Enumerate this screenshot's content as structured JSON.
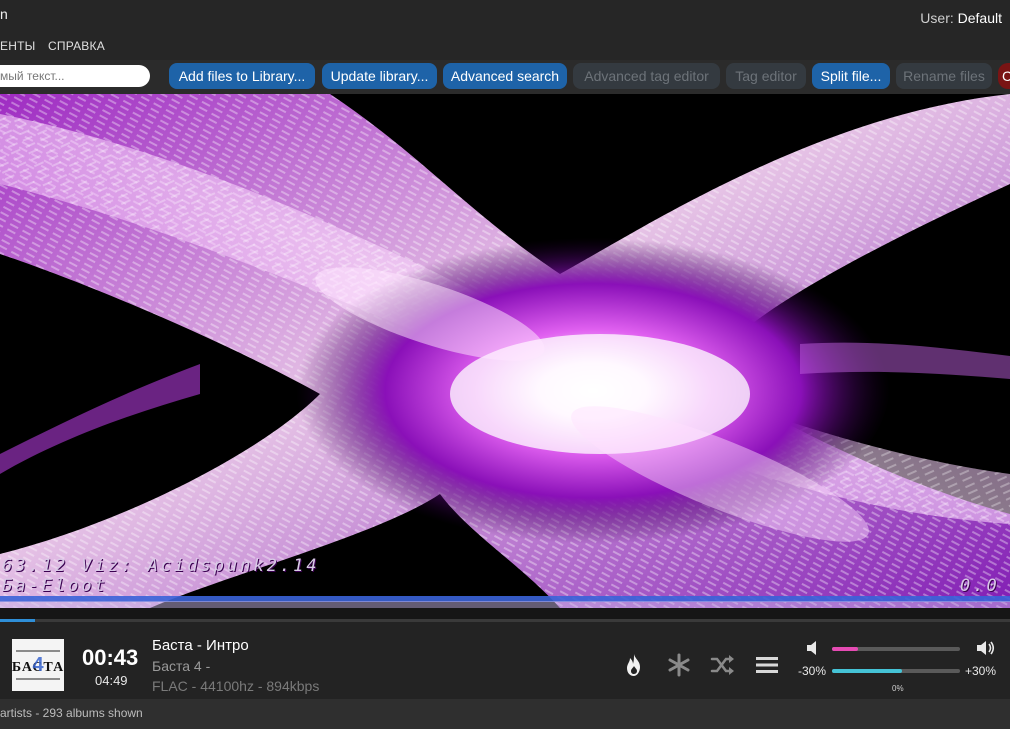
{
  "titlebar": {
    "app_title_fragment": "n",
    "user_label": "User:",
    "user_name": "Default"
  },
  "menu": {
    "items": [
      "ЕНТЫ",
      "СПРАВКА"
    ]
  },
  "toolbar": {
    "search_placeholder": "мый текст...",
    "buttons": [
      {
        "label": "Add files to Library...",
        "state": "active"
      },
      {
        "label": "Update library...",
        "state": "active"
      },
      {
        "label": "Advanced search",
        "state": "active"
      },
      {
        "label": "Advanced tag editor",
        "state": "disabled"
      },
      {
        "label": "Tag editor",
        "state": "disabled"
      },
      {
        "label": "Split file...",
        "state": "active"
      },
      {
        "label": "Rename files",
        "state": "disabled"
      },
      {
        "label": "C",
        "state": "red"
      }
    ]
  },
  "visualizer": {
    "osd_line1": "63.12   Viz: Acidspunk2.14",
    "osd_line2": "Бa-Eloot",
    "osd_right": "0.0"
  },
  "playback": {
    "progress": 0.035
  },
  "now_playing": {
    "time_elapsed": "00:43",
    "time_total": "04:49",
    "title": "Баста - Интро",
    "album": "Баста 4 -",
    "format": "FLAC - 44100hz - 894kbps",
    "cover_text": "БАСТА",
    "cover_number": "4"
  },
  "controls": {
    "icons": [
      "fire-icon",
      "asterisk-icon",
      "shuffle-icon",
      "menu-icon"
    ]
  },
  "volume": {
    "level": 0.2,
    "accent": "#e54bb3"
  },
  "balance": {
    "min_label": "-30%",
    "max_label": "+30%",
    "value_label": "0%",
    "level": 0.55,
    "accent": "#45c3d6"
  },
  "status": {
    "text": "artists - 293 albums shown"
  },
  "colors": {
    "button_active": "#1e63a8",
    "button_disabled": "#343a40",
    "progress": "#2f8fd8"
  }
}
